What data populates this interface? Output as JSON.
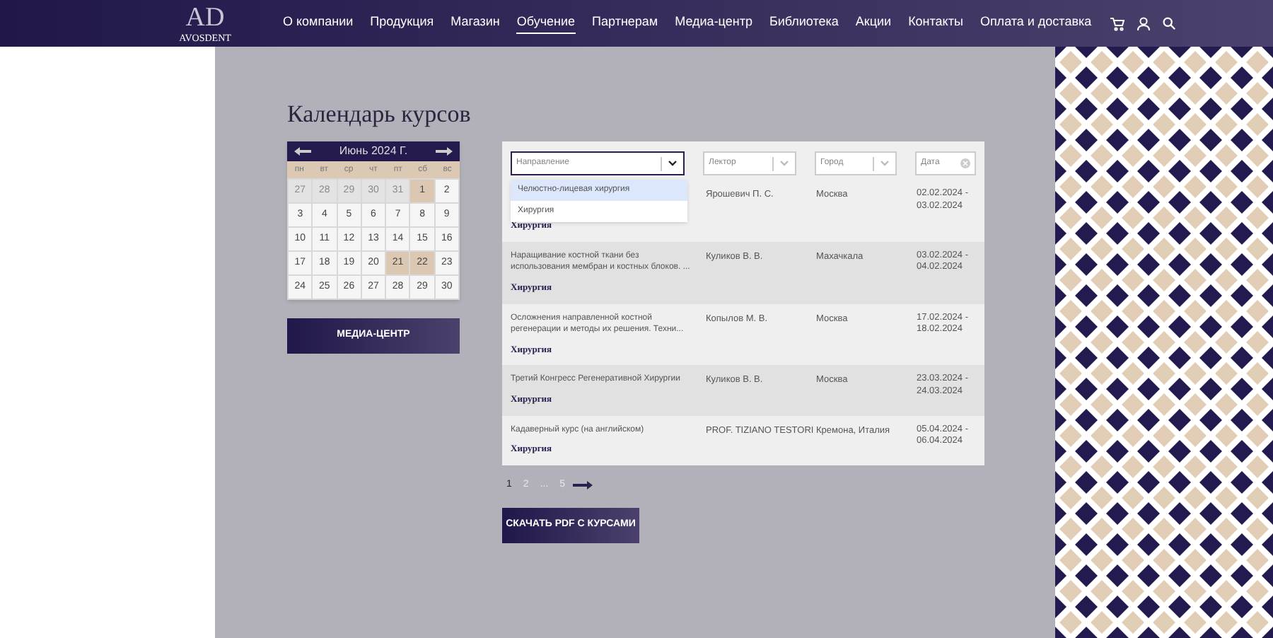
{
  "header": {
    "logo": {
      "letters": "AD",
      "brand": "AVOSDENT"
    },
    "nav": [
      {
        "label": "О компании",
        "selected": false
      },
      {
        "label": "Продукция",
        "selected": false
      },
      {
        "label": "Магазин",
        "selected": false
      },
      {
        "label": "Обучение",
        "selected": true
      },
      {
        "label": "Партнерам",
        "selected": false
      },
      {
        "label": "Медиа-центр",
        "selected": false
      },
      {
        "label": "Библиотека",
        "selected": false
      },
      {
        "label": "Акции",
        "selected": false
      },
      {
        "label": "Контакты",
        "selected": false
      },
      {
        "label": "Оплата и доставка",
        "selected": false
      }
    ]
  },
  "page_title": "Календарь курсов",
  "calendar": {
    "month": "Июнь 2024 Г.",
    "weekdays": [
      "пн",
      "вт",
      "ср",
      "чт",
      "пт",
      "сб",
      "вс"
    ],
    "days": [
      {
        "label": "27",
        "kind": "other"
      },
      {
        "label": "28",
        "kind": "other"
      },
      {
        "label": "29",
        "kind": "other"
      },
      {
        "label": "30",
        "kind": "other"
      },
      {
        "label": "31",
        "kind": "other"
      },
      {
        "label": "1",
        "kind": "event"
      },
      {
        "label": "2",
        "kind": "normal"
      },
      {
        "label": "3",
        "kind": "normal"
      },
      {
        "label": "4",
        "kind": "normal"
      },
      {
        "label": "5",
        "kind": "normal"
      },
      {
        "label": "6",
        "kind": "normal"
      },
      {
        "label": "7",
        "kind": "normal"
      },
      {
        "label": "8",
        "kind": "normal"
      },
      {
        "label": "9",
        "kind": "normal"
      },
      {
        "label": "10",
        "kind": "normal"
      },
      {
        "label": "11",
        "kind": "normal"
      },
      {
        "label": "12",
        "kind": "normal"
      },
      {
        "label": "13",
        "kind": "normal"
      },
      {
        "label": "14",
        "kind": "normal"
      },
      {
        "label": "15",
        "kind": "normal"
      },
      {
        "label": "16",
        "kind": "normal"
      },
      {
        "label": "17",
        "kind": "normal"
      },
      {
        "label": "18",
        "kind": "normal"
      },
      {
        "label": "19",
        "kind": "normal"
      },
      {
        "label": "20",
        "kind": "normal"
      },
      {
        "label": "21",
        "kind": "event"
      },
      {
        "label": "22",
        "kind": "event"
      },
      {
        "label": "23",
        "kind": "normal"
      },
      {
        "label": "24",
        "kind": "normal"
      },
      {
        "label": "25",
        "kind": "normal"
      },
      {
        "label": "26",
        "kind": "normal"
      },
      {
        "label": "27",
        "kind": "normal"
      },
      {
        "label": "28",
        "kind": "normal"
      },
      {
        "label": "29",
        "kind": "normal"
      },
      {
        "label": "30",
        "kind": "normal"
      }
    ]
  },
  "media_button": "МЕДИА-ЦЕНТР",
  "filters": [
    {
      "placeholder": "Направление",
      "kind": "select",
      "expanded": true
    },
    {
      "placeholder": "Лектор",
      "kind": "select",
      "expanded": false
    },
    {
      "placeholder": "Город",
      "kind": "select",
      "expanded": false
    },
    {
      "placeholder": "Дата",
      "kind": "date",
      "expanded": false
    }
  ],
  "dropdown": [
    {
      "label": "Челюстно-лицевая хирургия",
      "selected": true
    },
    {
      "label": "Хирургия",
      "selected": false
    }
  ],
  "courses": [
    {
      "lector": "Ярошевич П. С.",
      "city": "Москва",
      "date": "02.02.2024 -\n03.02.2024",
      "category": "Хирургия"
    },
    {
      "title": "Наращивание костной ткани без использования мембран и костных блоков. ...",
      "lector": "Куликов В. В.",
      "city": "Махачкала",
      "date": "03.02.2024 -\n04.02.2024",
      "category": "Хирургия"
    },
    {
      "title": "Осложнения направленной костной регенерации и методы их решения. Техни...",
      "lector": "Копылов М. В.",
      "city": "Москва",
      "date": "17.02.2024 -\n18.02.2024",
      "category": "Хирургия"
    },
    {
      "title": "Третий Конгресс Регенеративной Хирургии",
      "lector": "Куликов В. В.",
      "city": "Москва",
      "date": "23.03.2024 -\n24.03.2024",
      "category": "Хирургия"
    },
    {
      "title": "Кадаверный курс (на английском)",
      "lector": "PROF. TIZIANO TESTORI",
      "city": "Кремона, Италия",
      "date": "05.04.2024 -\n06.04.2024",
      "category": "Хирургия"
    }
  ],
  "pagination": [
    {
      "label": "1",
      "selected": true
    },
    {
      "label": "2",
      "selected": false
    },
    {
      "label": "...",
      "selected": false
    },
    {
      "label": "5",
      "selected": false
    }
  ],
  "pdf_button": "СКАЧАТЬ PDF С КУРСАМИ"
}
